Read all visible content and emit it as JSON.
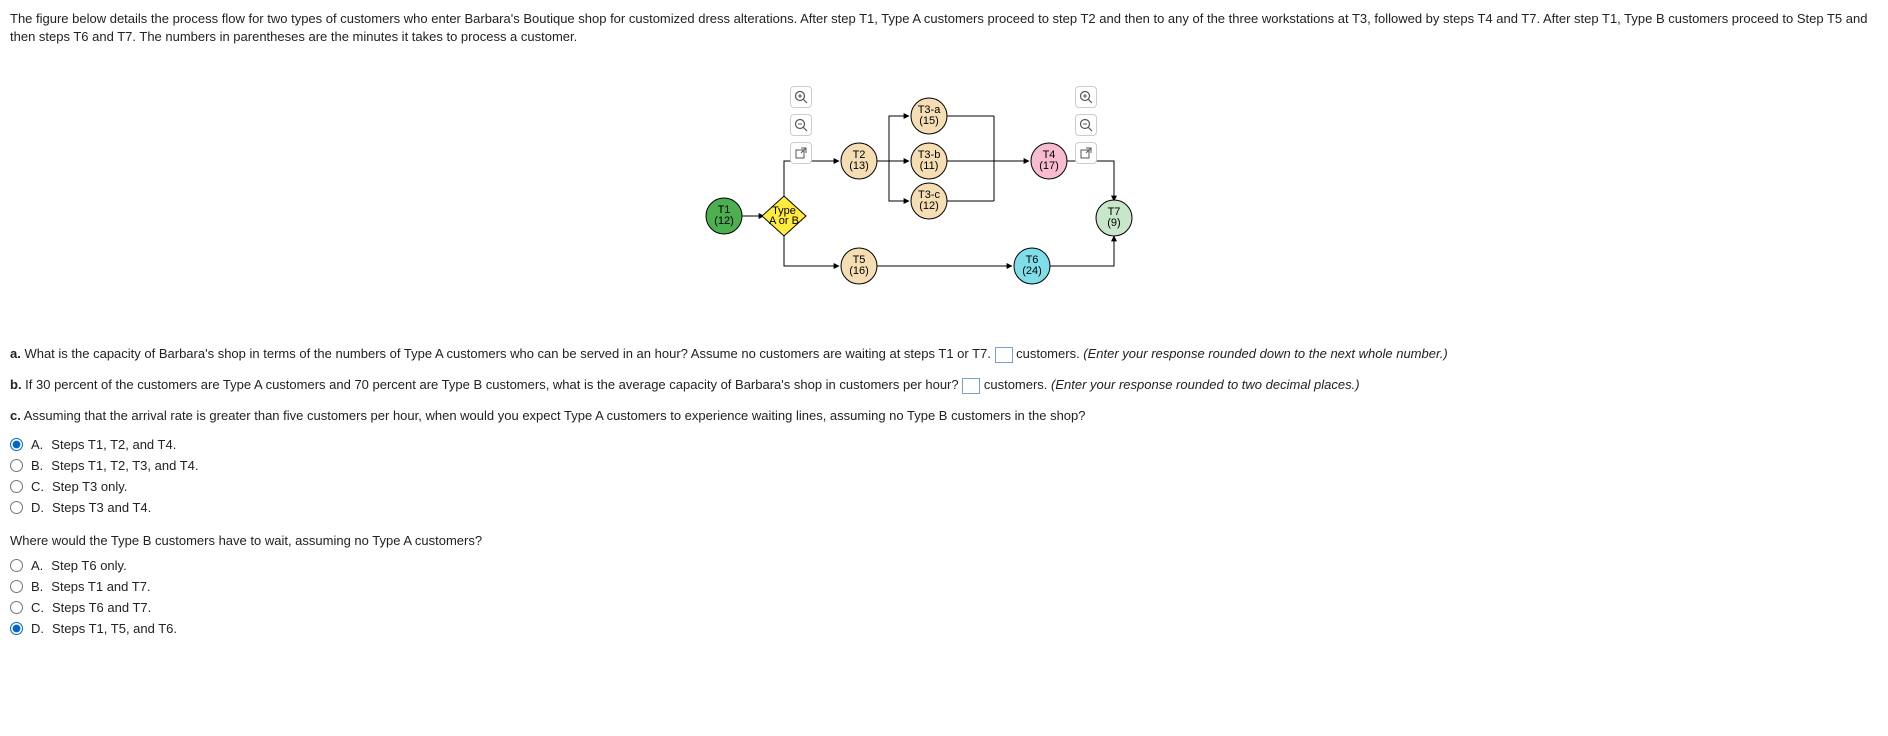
{
  "intro": "The figure below details the process flow for two types of customers who enter Barbara's Boutique shop for customized dress alterations. After step T1, Type A customers proceed to step T2 and then to any of the three workstations at T3, followed by steps T4 and T7. After step T1, Type B customers proceed to Step T5 and then steps T6 and T7. The numbers in parentheses are the minutes it takes to process a customer.",
  "nodes": {
    "t1": {
      "label": "T1",
      "time": "(12)"
    },
    "decision": {
      "line1": "Type",
      "line2": "A or B"
    },
    "t2": {
      "label": "T2",
      "time": "(13)"
    },
    "t3a": {
      "label": "T3-a",
      "time": "(15)"
    },
    "t3b": {
      "label": "T3-b",
      "time": "(11)"
    },
    "t3c": {
      "label": "T3-c",
      "time": "(12)"
    },
    "t4": {
      "label": "T4",
      "time": "(17)"
    },
    "t5": {
      "label": "T5",
      "time": "(16)"
    },
    "t6": {
      "label": "T6",
      "time": "(24)"
    },
    "t7": {
      "label": "T7",
      "time": "(9)"
    }
  },
  "qa": {
    "prefix": "a.",
    "text1": " What is the capacity of Barbara's shop in terms of the numbers of Type A customers who can be served in an hour? Assume no customers are waiting at steps T1 or T7. ",
    "text2": " customers. ",
    "hint": "(Enter your response rounded down to the next whole number.)"
  },
  "qb": {
    "prefix": "b.",
    "text1": " If 30 percent of the customers are Type A customers and 70 percent are Type B customers, what is the average capacity of Barbara's shop in customers per hour? ",
    "text2": " customers. ",
    "hint": "(Enter your response rounded to two decimal places.)"
  },
  "qc": {
    "prefix": "c.",
    "text1": " Assuming that the arrival rate is greater than five customers per hour, when would you expect Type A customers to experience waiting lines, assuming no Type B customers in the shop?"
  },
  "optionsC": [
    {
      "letter": "A.",
      "text": "Steps T1, T2, and T4.",
      "checked": true
    },
    {
      "letter": "B.",
      "text": "Steps T1, T2, T3, and T4.",
      "checked": false
    },
    {
      "letter": "C.",
      "text": "Step T3 only.",
      "checked": false
    },
    {
      "letter": "D.",
      "text": "Steps T3 and T4.",
      "checked": false
    }
  ],
  "subQuestion": "Where would the Type B customers have to wait, assuming no Type A customers?",
  "optionsD": [
    {
      "letter": "A.",
      "text": "Step T6 only.",
      "checked": false
    },
    {
      "letter": "B.",
      "text": "Steps T1 and T7.",
      "checked": false
    },
    {
      "letter": "C.",
      "text": "Steps T6 and T7.",
      "checked": false
    },
    {
      "letter": "D.",
      "text": "Steps T1, T5, and T6.",
      "checked": true
    }
  ],
  "icons": {
    "zoomIn": "⊕",
    "zoomOut": "⊖",
    "popout": "⧉"
  }
}
